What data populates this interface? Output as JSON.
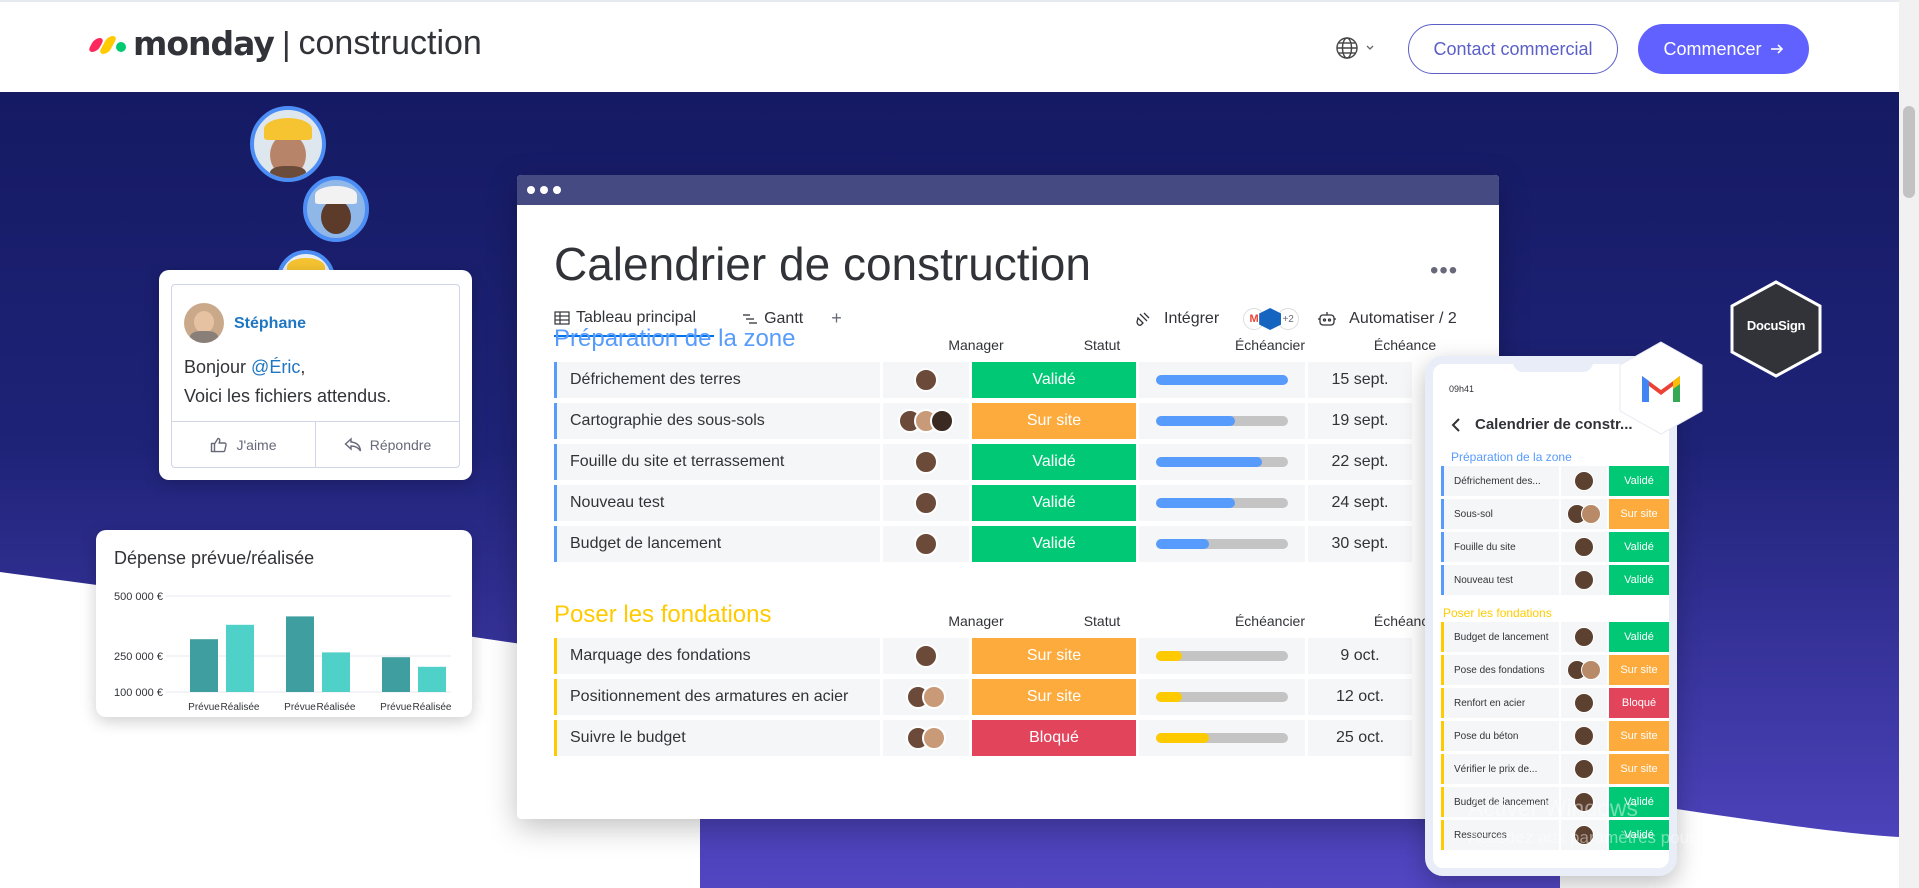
{
  "nav": {
    "brand_name": "monday",
    "brand_product": "construction",
    "contact_label": "Contact commercial",
    "start_label": "Commencer",
    "brand_colors": [
      "#fb275d",
      "#ffcb00",
      "#00ca72"
    ]
  },
  "post": {
    "author": "Stéphane",
    "greeting": "Bonjour ",
    "mention": "@Éric",
    "greeting_end": ",",
    "line2": "Voici les fichiers attendus.",
    "like_label": "J'aime",
    "reply_label": "Répondre"
  },
  "budget": {
    "title": "Dépense prévue/réalisée"
  },
  "chart_data": {
    "type": "bar",
    "title": "Dépense prévue/réalisée",
    "yticks": [
      "500 000 €",
      "250 000 €",
      "100 000 €"
    ],
    "ylim": [
      100000,
      500000
    ],
    "categories": [
      "Prévue",
      "Réalisée",
      "Prévue",
      "Réalisée",
      "Prévue",
      "Réalisée"
    ],
    "values": [
      320000,
      380000,
      415000,
      265000,
      245000,
      205000
    ],
    "colors": [
      "#3f9ea0",
      "#4fd0c8",
      "#3f9ea0",
      "#4fd0c8",
      "#3f9ea0",
      "#4fd0c8"
    ]
  },
  "board": {
    "title": "Calendrier de construction",
    "tabs": [
      "Tableau principal",
      "Gantt",
      "+"
    ],
    "integrate_label": "Intégrer",
    "integrations_more": "+2",
    "automate_label": "Automatiser / 2",
    "columns": [
      "Manager",
      "Statut",
      "Échéancier",
      "Échéance"
    ],
    "groups": [
      {
        "title": "Préparation de la zone",
        "color": "#579bfc",
        "rows": [
          {
            "task": "Défrichement des terres",
            "status": "Validé",
            "status_color": "#00c875",
            "timeline": 1.0,
            "timeline_color": "#579bfc",
            "due": "15 sept.",
            "people": 1
          },
          {
            "task": "Cartographie des sous-sols",
            "status": "Sur site",
            "status_color": "#fdab3d",
            "timeline": 0.6,
            "timeline_color": "#579bfc",
            "due": "19 sept.",
            "people": 3
          },
          {
            "task": "Fouille du site et terrassement",
            "status": "Validé",
            "status_color": "#00c875",
            "timeline": 0.8,
            "timeline_color": "#579bfc",
            "due": "22 sept.",
            "people": 1
          },
          {
            "task": "Nouveau test",
            "status": "Validé",
            "status_color": "#00c875",
            "timeline": 0.6,
            "timeline_color": "#579bfc",
            "due": "24 sept.",
            "people": 1
          },
          {
            "task": "Budget de lancement",
            "status": "Validé",
            "status_color": "#00c875",
            "timeline": 0.4,
            "timeline_color": "#579bfc",
            "due": "30 sept.",
            "people": 1
          }
        ]
      },
      {
        "title": "Poser les fondations",
        "color": "#ffcb00",
        "rows": [
          {
            "task": "Marquage des fondations",
            "status": "Sur site",
            "status_color": "#fdab3d",
            "timeline": 0.2,
            "timeline_color": "#ffcb00",
            "due": "9 oct.",
            "people": 1
          },
          {
            "task": "Positionnement des armatures en acier",
            "status": "Sur site",
            "status_color": "#fdab3d",
            "timeline": 0.2,
            "timeline_color": "#ffcb00",
            "due": "12 oct.",
            "people": 2
          },
          {
            "task": "Suivre le budget",
            "status": "Bloqué",
            "status_color": "#e2445c",
            "timeline": 0.4,
            "timeline_color": "#ffcb00",
            "due": "25 oct.",
            "people": 2
          }
        ]
      }
    ]
  },
  "phone": {
    "time": "09h41",
    "title": "Calendrier de constr...",
    "groups": [
      {
        "title": "Préparation de la zone",
        "color": "#579bfc",
        "rows": [
          {
            "task": "Défrichement des...",
            "status": "Validé",
            "status_color": "#00c875",
            "people": 1
          },
          {
            "task": "Sous-sol",
            "status": "Sur site",
            "status_color": "#fdab3d",
            "people": 2
          },
          {
            "task": "Fouille du site",
            "status": "Validé",
            "status_color": "#00c875",
            "people": 1
          },
          {
            "task": "Nouveau test",
            "status": "Validé",
            "status_color": "#00c875",
            "people": 1
          }
        ]
      },
      {
        "title": "Poser les fondations",
        "color": "#ffcb00",
        "rows": [
          {
            "task": "Budget de lancement",
            "status": "Validé",
            "status_color": "#00c875",
            "people": 1
          },
          {
            "task": "Pose des fondations",
            "status": "Sur site",
            "status_color": "#fdab3d",
            "people": 2
          },
          {
            "task": "Renfort en acier",
            "status": "Bloqué",
            "status_color": "#e2445c",
            "people": 1
          },
          {
            "task": "Pose du béton",
            "status": "Sur site",
            "status_color": "#fdab3d",
            "people": 1
          },
          {
            "task": "Vérifier le prix de...",
            "status": "Sur site",
            "status_color": "#fdab3d",
            "people": 1
          },
          {
            "task": "Budget de lancement",
            "status": "Validé",
            "status_color": "#00c875",
            "people": 1
          },
          {
            "task": "Ressources",
            "status": "Validé",
            "status_color": "#00c875",
            "people": 1
          }
        ]
      }
    ]
  },
  "badges": {
    "docusign": "DocuSign",
    "gmail": "M"
  },
  "watermark": {
    "title": "Activer Windows",
    "subtitle": "Accédez aux paramètres pour activer Windows."
  }
}
